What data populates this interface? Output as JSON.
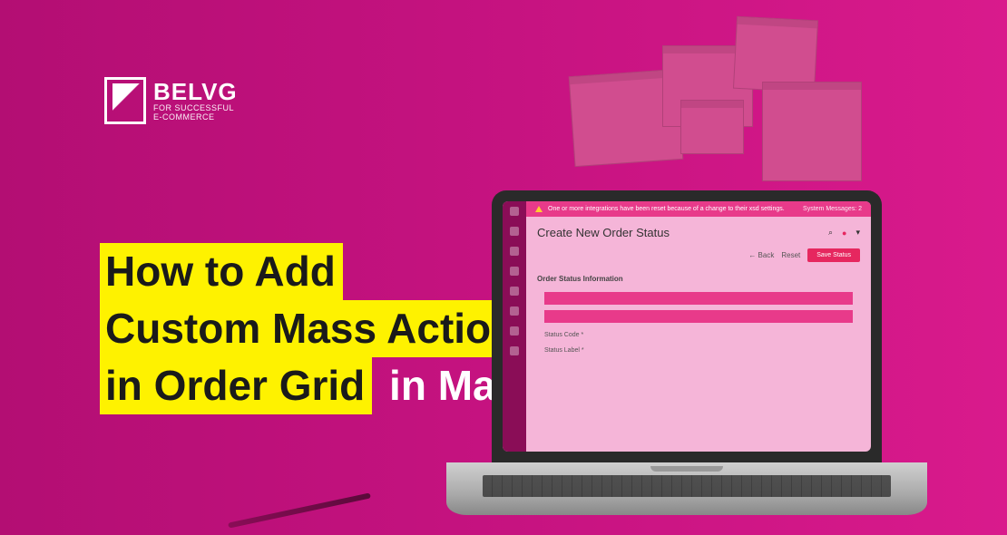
{
  "logo": {
    "brand": "BELVG",
    "tagline_line1": "FOR SUCCESSFUL",
    "tagline_line2": "E-COMMERCE"
  },
  "headline": {
    "line1": "How to Add",
    "line2": "Custom Mass Action",
    "line3a": "in Order Grid",
    "line3b": " in Magento 2"
  },
  "laptop_screen": {
    "alert_text": "One or more integrations have been reset because of a change to their xsd settings.",
    "alert_right": "System Messages: 2",
    "page_title": "Create New Order Status",
    "search_icon": "⌕",
    "notif_icon": "●",
    "user_icon": "▾",
    "back_button": "← Back",
    "reset_button": "Reset",
    "save_button": "Save Status",
    "section_title": "Order Status Information",
    "label_status_code": "Status Code *",
    "label_status_label": "Status Label *"
  }
}
